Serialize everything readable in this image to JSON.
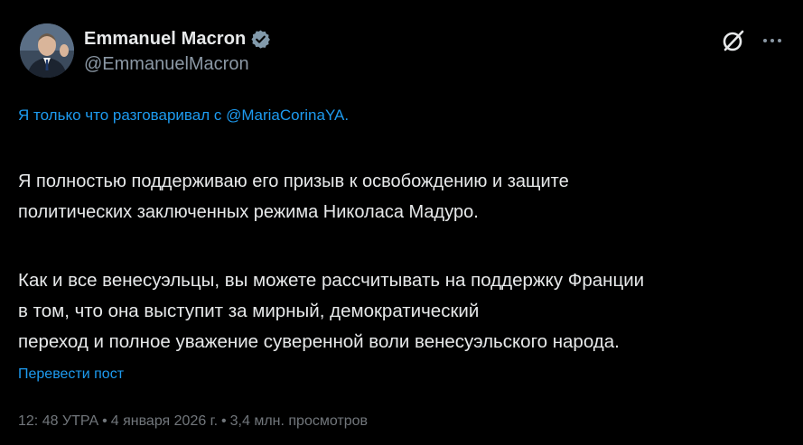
{
  "author": {
    "display_name": "Emmanuel Macron",
    "handle": "@EmmanuelMacron"
  },
  "tweet": {
    "mention_prefix": "Я только что разговаривал с ",
    "mention": "@MariaCorinaYA",
    "mention_suffix": ".",
    "paragraph_1_line_1": "Я полностью поддерживаю его призыв к освобождению и защите",
    "paragraph_1_line_2": "политических заключенных режима Николаса Мадуро.",
    "paragraph_2_line_1": "Как и все венесуэльцы, вы можете рассчитывать на поддержку Франции",
    "paragraph_2_line_2": "в том, что она выступит за мирный, демократический",
    "paragraph_2_line_3": "переход и полное уважение суверенной воли венесуэльского народа.",
    "translate_label": "Перевести пост"
  },
  "meta": {
    "time": "12: 48 УТРА",
    "date": "4 января 2026 г.",
    "views": "3,4 млн. просмотров",
    "separator": "•"
  },
  "icons": {
    "verified": "verified-badge-icon",
    "grok": "grok-icon",
    "more": "more-horizontal-icon"
  },
  "colors": {
    "background": "#000000",
    "text": "#e7e9ea",
    "secondary": "#71767b",
    "accent": "#1d9bf0"
  }
}
